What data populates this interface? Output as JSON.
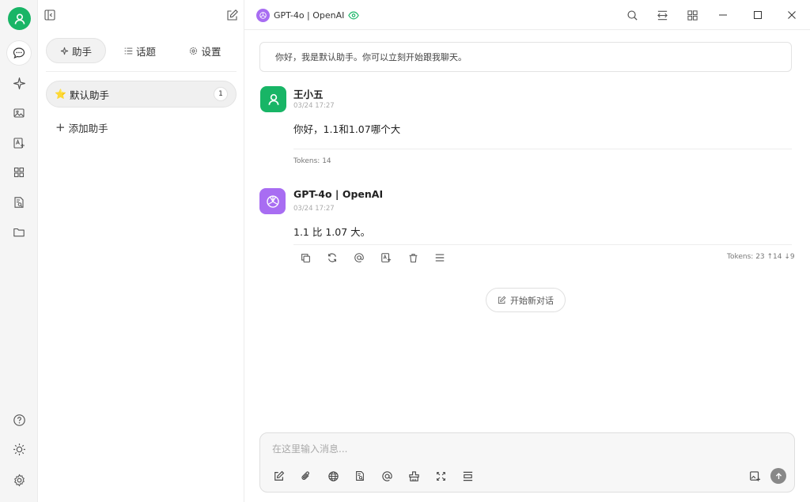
{
  "rail": {
    "items": [
      "chat-icon",
      "sparkle-icon",
      "image-icon",
      "translate-icon",
      "apps-icon",
      "files-search-icon",
      "folder-icon"
    ],
    "bottom": [
      "help-icon",
      "sun-icon",
      "settings-icon"
    ]
  },
  "panel": {
    "tabs": [
      {
        "label": "助手",
        "icon": "sparkle-icon"
      },
      {
        "label": "话题",
        "icon": "list-icon"
      },
      {
        "label": "设置",
        "icon": "gear-icon"
      }
    ],
    "assistant": {
      "emoji": "⭐",
      "label": "默认助手",
      "count": "1"
    },
    "add_label": "添加助手"
  },
  "header": {
    "model": "GPT-4o | OpenAI"
  },
  "chat": {
    "welcome": "你好，我是默认助手。你可以立刻开始跟我聊天。",
    "messages": [
      {
        "name": "王小五",
        "time": "03/24 17:27",
        "text": "你好，1.1和1.07哪个大",
        "tokens": "Tokens: 14"
      },
      {
        "name": "GPT-4o | OpenAI",
        "time": "03/24 17:27",
        "text": "1.1 比 1.07 大。",
        "tokens": "Tokens: 23 ↑14 ↓9"
      }
    ],
    "new_chat": "开始新对话"
  },
  "input": {
    "placeholder": "在这里输入消息..."
  },
  "colors": {
    "user_green": "#18b566",
    "gpt_purple": "#a86df2"
  }
}
